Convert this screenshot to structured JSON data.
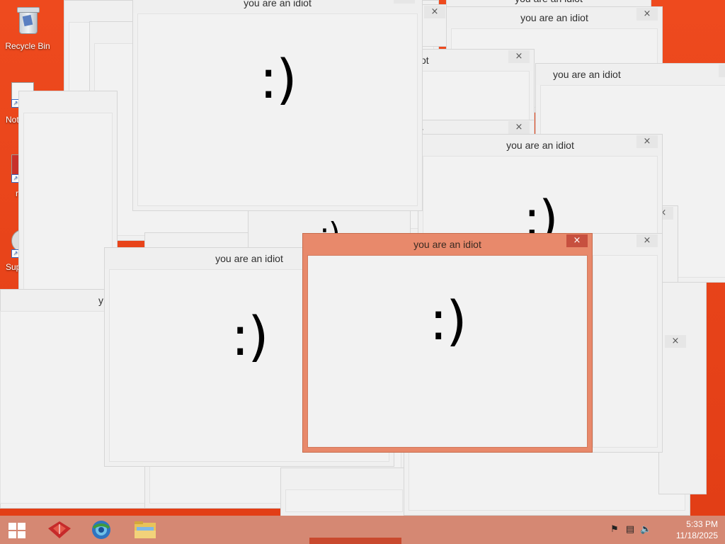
{
  "desktop": {
    "icons": [
      {
        "label": "Recycle Bin"
      },
      {
        "label": "Not"
      },
      {
        "label": "r"
      },
      {
        "label": "Sup"
      }
    ]
  },
  "window_title": "you are an idiot",
  "window_title_fragments": [
    "ot",
    "t",
    "y"
  ],
  "face": ":)",
  "close_glyph": "×",
  "taskbar": {
    "clock_time": "5:33 PM",
    "clock_date": "11/18/2025"
  },
  "colors": {
    "desktop": "#e8431b",
    "active_window": "#e8896b",
    "active_close": "#c7503f",
    "taskbar": "#d48c78"
  }
}
